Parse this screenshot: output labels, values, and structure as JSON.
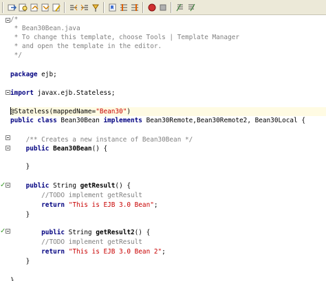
{
  "toolbar": {
    "buttons": [
      {
        "name": "back-icon"
      },
      {
        "name": "find-selection-icon"
      },
      {
        "name": "find-previous-icon"
      },
      {
        "name": "find-next-icon"
      },
      {
        "name": "toggle-highlight-icon"
      },
      {
        "name": "shift-left-icon"
      },
      {
        "name": "shift-right-icon"
      },
      {
        "name": "toggle-bookmark-icon"
      },
      {
        "name": "previous-bookmark-icon"
      },
      {
        "name": "next-bookmark-icon"
      },
      {
        "name": "start-macro-icon"
      },
      {
        "name": "stop-macro-icon"
      },
      {
        "name": "comment-icon"
      },
      {
        "name": "uncomment-icon"
      }
    ]
  },
  "code": {
    "l1": "/*",
    "l2": " * Bean30Bean.java",
    "l3": " * To change this template, choose Tools | Template Manager",
    "l4": " * and open the template in the editor.",
    "l5": " */",
    "l6_kw": "package",
    "l6_rest": " ejb;",
    "l7_kw": "import",
    "l7_rest": " javax.ejb.Stateless;",
    "l8_ann": "@Stateless(mappedName=",
    "l8_str": "\"Bean30\"",
    "l8_end": ")",
    "l9_kw1": "public class",
    "l9_mid": " Bean30Bean ",
    "l9_kw2": "implements",
    "l9_rest": " Bean30Remote,Bean30Remote2, Bean30Local {",
    "l10": "/** Creates a new instance of Bean30Bean */",
    "l11_kw": "public",
    "l11_name": "Bean30Bean",
    "l11_rest": "() {",
    "l12": "}",
    "l13_kw": "public",
    "l13_type": " String ",
    "l13_name": "getResult",
    "l13_rest": "() {",
    "l14": "//TODO implement getResult",
    "l15_kw": "return",
    "l15_str": "\"This is EJB 3.0 Bean\"",
    "l15_end": ";",
    "l16": "}",
    "l17_kw": "public",
    "l17_type": " String ",
    "l17_name": "getResult2",
    "l17_rest": "() {",
    "l18": "//TODO implement getResult",
    "l19_kw": "return",
    "l19_str": "\"This is EJB 3.0 Bean 2\"",
    "l19_end": ";",
    "l20": "}",
    "l21": "}"
  },
  "colors": {
    "keyword": "#000080",
    "string": "#c80000",
    "comment": "#808080",
    "current_line": "#fffbe3"
  }
}
